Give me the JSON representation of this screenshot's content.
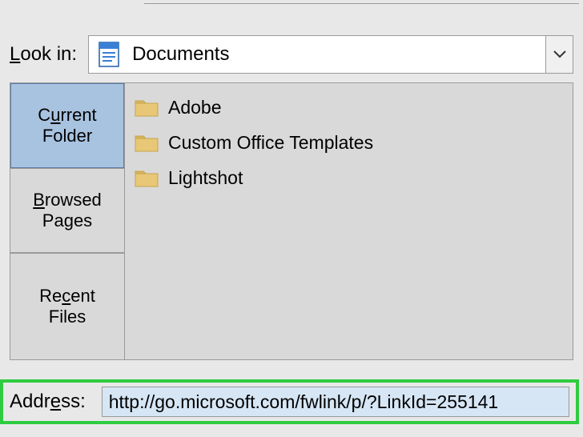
{
  "lookin": {
    "label": "Look in:",
    "selected": "Documents"
  },
  "sidebar": {
    "items": [
      {
        "line1": "Current",
        "line2": "Folder",
        "selected": true
      },
      {
        "line1": "Browsed",
        "line2": "Pages",
        "selected": false
      },
      {
        "line1": "Recent",
        "line2": "Files",
        "selected": false
      }
    ]
  },
  "files": [
    {
      "name": "Adobe",
      "type": "folder"
    },
    {
      "name": "Custom Office Templates",
      "type": "folder"
    },
    {
      "name": "Lightshot",
      "type": "folder"
    }
  ],
  "address": {
    "label": "Address:",
    "value": "http://go.microsoft.com/fwlink/p/?LinkId=255141"
  },
  "colors": {
    "highlight": "#2ecc40",
    "selected_tab": "#a8c3e0"
  }
}
